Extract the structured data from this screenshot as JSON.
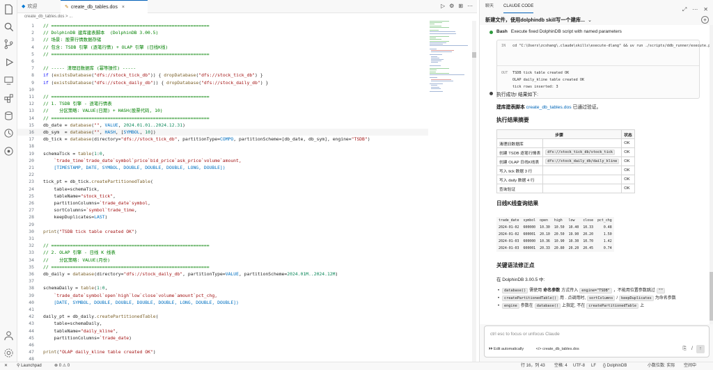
{
  "editor": {
    "tabs": [
      {
        "label": "欢迎",
        "icon": "vscode-logo-icon"
      },
      {
        "label": "create_db_tables.dos",
        "icon": "file-icon",
        "close": "×"
      }
    ],
    "breadcrumb": "create_db_tables.dos > ...",
    "actions": [
      "▷",
      "⚙",
      "⊞",
      "⋯"
    ],
    "lines": [
      {
        "n": "1",
        "t": "// ===========================================================",
        "c": "cm"
      },
      {
        "n": "2",
        "t": "// DolphinDB 建库建表脚本  (DolphinDB 3.00.5)",
        "c": "cm"
      },
      {
        "n": "3",
        "t": "// 场景: 股票行情数据存储",
        "c": "cm"
      },
      {
        "n": "4",
        "t": "// 包含: TSDB 引擎 (逐笔行情) + OLAP 引擎 (日线K线)",
        "c": "cm"
      },
      {
        "n": "5",
        "t": "// ===========================================================",
        "c": "cm"
      },
      {
        "n": "6",
        "t": "",
        "c": "plain"
      },
      {
        "n": "7",
        "t": "// ----- 清理旧数据库 (幂等操作) -----",
        "c": "cm"
      },
      {
        "n": "8",
        "t": "if (existsDatabase(\"dfs://stock_tick_db\")) { dropDatabase(\"dfs://stock_tick_db\") }",
        "c": "mix"
      },
      {
        "n": "9",
        "t": "if (existsDatabase(\"dfs://stock_daily_db\")) { dropDatabase(\"dfs://stock_daily_db\") }",
        "c": "mix"
      },
      {
        "n": "10",
        "t": "",
        "c": "plain"
      },
      {
        "n": "11",
        "t": "// ===========================================================",
        "c": "cm"
      },
      {
        "n": "12",
        "t": "// 1. TSDB 引擎 - 逐笔行情表",
        "c": "cm"
      },
      {
        "n": "13",
        "t": "//    分区策略: VALUE(日期) + HASH(股票代码, 10)",
        "c": "cm"
      },
      {
        "n": "14",
        "t": "// ===========================================================",
        "c": "cm"
      },
      {
        "n": "15",
        "t": "db_date = database(\"\", VALUE, 2024.01.01..2024.12.31)",
        "c": "mix"
      },
      {
        "n": "16",
        "t": "db_sym  = database(\"\", HASH, [SYMBOL, 10])",
        "c": "mix"
      },
      {
        "n": "17",
        "t": "db_tick = database(directory=\"dfs://stock_tick_db\", partitionType=COMPO, partitionScheme=[db_date, db_sym], engine=\"TSDB\")",
        "c": "mix"
      },
      {
        "n": "18",
        "t": "",
        "c": "plain"
      },
      {
        "n": "19",
        "t": "schemaTick = table(1:0,",
        "c": "mix"
      },
      {
        "n": "20",
        "t": "    `trade_time`trade_date`symbol`price`bid_price`ask_price`volume`amount,",
        "c": "str"
      },
      {
        "n": "21",
        "t": "    [TIMESTAMP, DATE, SYMBOL, DOUBLE, DOUBLE, DOUBLE, LONG, DOUBLE])",
        "c": "cst"
      },
      {
        "n": "22",
        "t": "",
        "c": "plain"
      },
      {
        "n": "23",
        "t": "tick_pt = db_tick.createPartitionedTable(",
        "c": "mix"
      },
      {
        "n": "24",
        "t": "    table=schemaTick,",
        "c": "plain"
      },
      {
        "n": "25",
        "t": "    tableName=\"stock_tick\",",
        "c": "mix"
      },
      {
        "n": "26",
        "t": "    partitionColumns=`trade_date`symbol,",
        "c": "mix"
      },
      {
        "n": "27",
        "t": "    sortColumns=`symbol`trade_time,",
        "c": "mix"
      },
      {
        "n": "28",
        "t": "    keepDuplicates=LAST)",
        "c": "mix"
      },
      {
        "n": "29",
        "t": "",
        "c": "plain"
      },
      {
        "n": "30",
        "t": "print(\"TSDB tick table created OK\")",
        "c": "mix"
      },
      {
        "n": "31",
        "t": "",
        "c": "plain"
      },
      {
        "n": "32",
        "t": "// ===========================================================",
        "c": "cm"
      },
      {
        "n": "33",
        "t": "// 2. OLAP 引擎 - 日线 K 线表",
        "c": "cm"
      },
      {
        "n": "34",
        "t": "//    分区策略: VALUE(月份)",
        "c": "cm"
      },
      {
        "n": "35",
        "t": "// ===========================================================",
        "c": "cm"
      },
      {
        "n": "36",
        "t": "db_daily = database(directory=\"dfs://stock_daily_db\", partitionType=VALUE, partitionScheme=2024.01M..2024.12M)",
        "c": "mix"
      },
      {
        "n": "37",
        "t": "",
        "c": "plain"
      },
      {
        "n": "38",
        "t": "schemaDaily = table(1:0,",
        "c": "mix"
      },
      {
        "n": "39",
        "t": "    `trade_date`symbol`open`high`low`close`volume`amount`pct_chg,",
        "c": "str"
      },
      {
        "n": "40",
        "t": "    [DATE, SYMBOL, DOUBLE, DOUBLE, DOUBLE, DOUBLE, LONG, DOUBLE, DOUBLE])",
        "c": "cst"
      },
      {
        "n": "41",
        "t": "",
        "c": "plain"
      },
      {
        "n": "42",
        "t": "daily_pt = db_daily.createPartitionedTable(",
        "c": "mix"
      },
      {
        "n": "43",
        "t": "    table=schemaDaily,",
        "c": "plain"
      },
      {
        "n": "44",
        "t": "    tableName=\"daily_kline\",",
        "c": "mix"
      },
      {
        "n": "45",
        "t": "    partitionColumns=`trade_date)",
        "c": "mix"
      },
      {
        "n": "46",
        "t": "",
        "c": "plain"
      },
      {
        "n": "47",
        "t": "print(\"OLAP daily_kline table created OK\")",
        "c": "mix"
      },
      {
        "n": "48",
        "t": "",
        "c": "plain"
      }
    ]
  },
  "panel": {
    "tabs": [
      "聊天",
      "CLAUDE CODE"
    ],
    "session_title": "新建文件，使用dolphindb skill写一个建库...",
    "bash_label": "Bash",
    "bash_desc": "Execute fixed DolphinDB script with named parameters",
    "cmd_in_tag": "IN",
    "cmd_in": "cd \"C:\\Users\\zcshang\\.claude\\skills\\execute-dlang\" && uv run ./scripts/ddb_runner/execute.p",
    "cmd_out_tag": "OUT",
    "cmd_out": [
      "TSDB tick table created OK",
      "OLAP daily_kline table created OK",
      "tick rows inserted: 3"
    ],
    "success": "执行成功! 结果如下:",
    "built_prefix": "建库建表脚本",
    "built_link": "create_db_tables.dos",
    "built_suffix": "已通过验证。",
    "summary_heading": "执行结果摘要",
    "summary_headers": [
      "步骤",
      "",
      "状态"
    ],
    "summary_rows": [
      {
        "step": "清理旧数据库",
        "chip": "",
        "status": "OK"
      },
      {
        "step": "创建 TSDB 逐笔行情表",
        "chip": "dfs://stock_tick_db/stock_tick",
        "status": "OK"
      },
      {
        "step": "创建 OLAP 日线K线表",
        "chip": "dfs://stock_daily_db/daily_kline",
        "status": "OK"
      },
      {
        "step": "写入 tick 数据 3 行",
        "chip": "",
        "status": "OK"
      },
      {
        "step": "写入 daily 数据 4 行",
        "chip": "",
        "status": "OK"
      },
      {
        "step": "查询验证",
        "chip": "",
        "status": "OK"
      }
    ],
    "kline_heading": "日线K线查询结果",
    "kline_headers": [
      "trade_date",
      "symbol",
      "open",
      "high",
      "low",
      "close",
      "pct_chg"
    ],
    "kline_rows": [
      [
        "2024-01-02",
        "600000",
        "10.30",
        "10.50",
        "10.40",
        "10.33",
        "0.48"
      ],
      [
        "2024-01-02",
        "600001",
        "20.10",
        "20.50",
        "19.90",
        "20.20",
        "1.50"
      ],
      [
        "2024-01-03",
        "600000",
        "10.36",
        "10.90",
        "10.30",
        "10.70",
        "1.42"
      ],
      [
        "2024-01-03",
        "600001",
        "20.33",
        "20.80",
        "20.20",
        "20.45",
        "0.74"
      ]
    ],
    "syntax_heading": "关键语法修正点",
    "syntax_intro": "在 DolphinDB 3.00.5 中:",
    "bullets": [
      {
        "chip1": "database()",
        "text1": "需使用",
        "bold": "命名参数",
        "text2": "方式传入",
        "chip2": "engine=\"TSDB\"",
        "text3": "，不能用位置参数跳过",
        "chip3": "\"\""
      },
      {
        "chip1": "createPartitionedTable()",
        "text1": "用",
        "bold": "",
        "text2": ". 点调用时,",
        "chip2": "sortColumns",
        "text3": "/",
        "chip3": "keepDuplicates",
        "text4": "为命名参数"
      },
      {
        "chip1": "engine",
        "text1": "参数在",
        "bold": "",
        "text2": "",
        "chip2": "database()",
        "text3": "上指定, 不在",
        "chip3": "createPartitionedTable",
        "text4": "上"
      }
    ],
    "input_placeholder": "ctrl esc to focus or unfocus Claude",
    "footer_edit": "Edit automatically",
    "footer_file": "create_db_tables.dos"
  },
  "status": {
    "left": [
      "✕",
      "Launchpad",
      "⊗ 0 ⚠ 0"
    ],
    "right": [
      "行 16，列 43",
      "空格: 4",
      "UTF-8",
      "LF",
      "{} DolphinDB",
      "小数位数: 实际",
      "空间中"
    ]
  },
  "colors": {
    "accent": "#005fb8",
    "comment": "#008000",
    "keyword": "#0000ff",
    "string": "#a31515",
    "success_dot": "#2e9b3e"
  }
}
